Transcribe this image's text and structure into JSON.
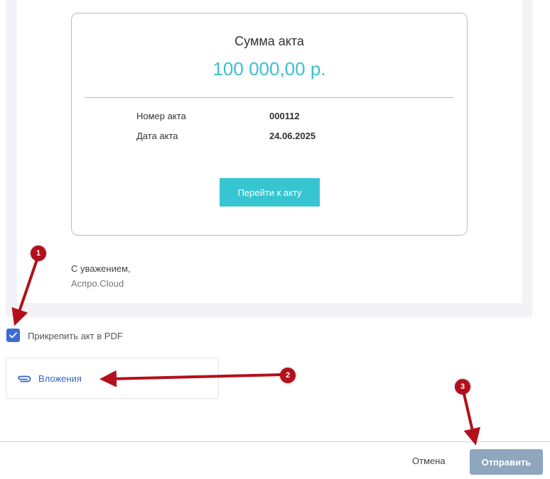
{
  "card": {
    "title": "Сумма акта",
    "amount": "100 000,00 р.",
    "rows": [
      {
        "label": "Номер акта",
        "value": "000112"
      },
      {
        "label": "Дата акта",
        "value": "24.06.2025"
      }
    ],
    "button_label": "Перейти к акту"
  },
  "signature": {
    "regards": "С уважением,",
    "company": "Аспро.Cloud"
  },
  "attach_pdf": {
    "label": "Прикрепить акт в PDF",
    "checked": true
  },
  "attachments": {
    "label": "Вложения",
    "icon": "paperclip-icon"
  },
  "footer": {
    "cancel_label": "Отмена",
    "send_label": "Отправить"
  },
  "annotations": {
    "markers": [
      "1",
      "2",
      "3"
    ],
    "color": "#b3101b"
  },
  "colors": {
    "accent": "#38c5d2",
    "amount": "#3cc0cf",
    "checkbox": "#3e6ad6",
    "link": "#3462c9",
    "send_button": "#8ea6be"
  }
}
